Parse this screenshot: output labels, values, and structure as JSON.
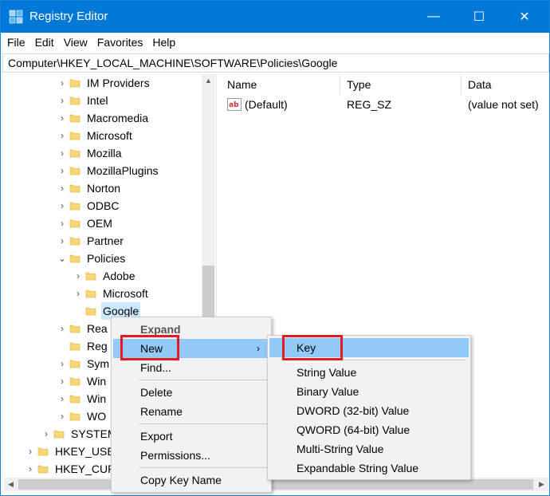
{
  "window": {
    "title": "Registry Editor",
    "controls": {
      "minimize": "—",
      "maximize": "☐",
      "close": "✕"
    }
  },
  "menubar": {
    "items": [
      "File",
      "Edit",
      "View",
      "Favorites",
      "Help"
    ]
  },
  "address": "Computer\\HKEY_LOCAL_MACHINE\\SOFTWARE\\Policies\\Google",
  "tree": {
    "items": [
      {
        "label": "IM Providers",
        "level": 3,
        "expander": "›"
      },
      {
        "label": "Intel",
        "level": 3,
        "expander": "›"
      },
      {
        "label": "Macromedia",
        "level": 3,
        "expander": "›"
      },
      {
        "label": "Microsoft",
        "level": 3,
        "expander": "›"
      },
      {
        "label": "Mozilla",
        "level": 3,
        "expander": "›"
      },
      {
        "label": "MozillaPlugins",
        "level": 3,
        "expander": "›"
      },
      {
        "label": "Norton",
        "level": 3,
        "expander": "›"
      },
      {
        "label": "ODBC",
        "level": 3,
        "expander": "›"
      },
      {
        "label": "OEM",
        "level": 3,
        "expander": "›"
      },
      {
        "label": "Partner",
        "level": 3,
        "expander": "›"
      },
      {
        "label": "Policies",
        "level": 3,
        "expander": "⌄"
      },
      {
        "label": "Adobe",
        "level": 4,
        "expander": "›"
      },
      {
        "label": "Microsoft",
        "level": 4,
        "expander": "›"
      },
      {
        "label": "Google",
        "level": 4,
        "expander": "",
        "selected": true
      },
      {
        "label": "Rea",
        "level": 3,
        "expander": "›"
      },
      {
        "label": "Reg",
        "level": 3,
        "expander": ""
      },
      {
        "label": "Sym",
        "level": 3,
        "expander": "›"
      },
      {
        "label": "Win",
        "level": 3,
        "expander": "›"
      },
      {
        "label": "Win",
        "level": 3,
        "expander": "›"
      },
      {
        "label": "WO",
        "level": 3,
        "expander": "›"
      },
      {
        "label": "SYSTEM",
        "level": 2,
        "expander": "›"
      },
      {
        "label": "HKEY_USE",
        "level": 1,
        "expander": "›"
      },
      {
        "label": "HKEY_CUR",
        "level": 1,
        "expander": "›"
      }
    ]
  },
  "values": {
    "columns": [
      "Name",
      "Type",
      "Data"
    ],
    "rows": [
      {
        "name": "(Default)",
        "type": "REG_SZ",
        "data": "(value not set)",
        "icon": "ab-string-icon"
      }
    ]
  },
  "context_menu": {
    "items": [
      {
        "label": "Expand",
        "style": "bold"
      },
      {
        "label": "New",
        "submenu": true,
        "highlighted": true
      },
      {
        "label": "Find..."
      },
      {
        "separator": true
      },
      {
        "label": "Delete"
      },
      {
        "label": "Rename"
      },
      {
        "separator": true
      },
      {
        "label": "Export"
      },
      {
        "label": "Permissions..."
      },
      {
        "separator": true
      },
      {
        "label": "Copy Key Name"
      }
    ]
  },
  "submenu": {
    "items": [
      {
        "label": "Key",
        "highlighted": true
      },
      {
        "separator": true
      },
      {
        "label": "String Value"
      },
      {
        "label": "Binary Value"
      },
      {
        "label": "DWORD (32-bit) Value"
      },
      {
        "label": "QWORD (64-bit) Value"
      },
      {
        "label": "Multi-String Value"
      },
      {
        "label": "Expandable String Value"
      }
    ]
  },
  "colors": {
    "titlebar": "#0078d7",
    "selection": "#cce8ff",
    "menu_highlight": "#91c9f7",
    "annotation": "#e31b23",
    "folder": "#f8d775"
  }
}
